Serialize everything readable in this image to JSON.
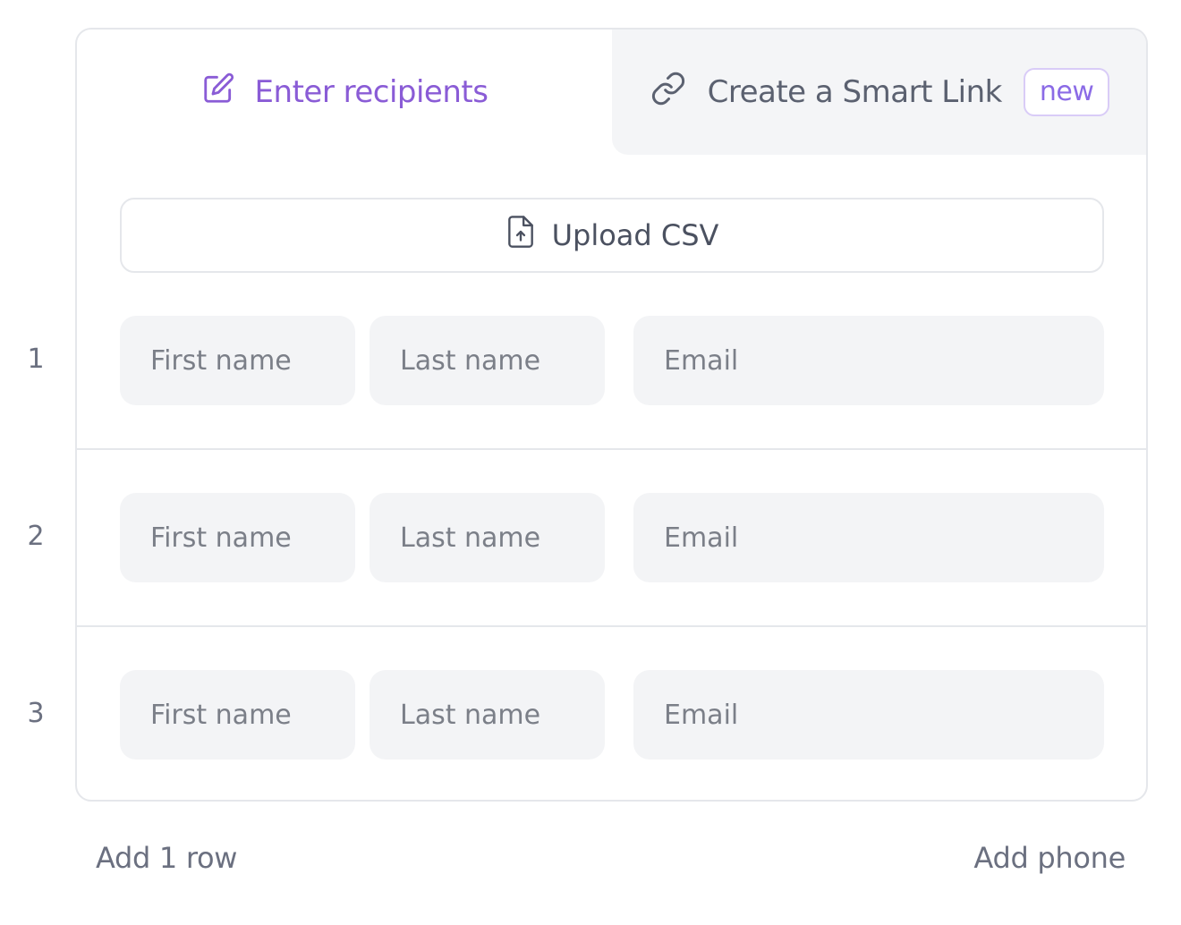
{
  "tabs": {
    "enter_label": "Enter recipients",
    "smart_label": "Create a Smart Link",
    "smart_badge": "new"
  },
  "upload": {
    "label": "Upload CSV"
  },
  "rows": [
    {
      "number": "1",
      "first_placeholder": "First name",
      "last_placeholder": "Last name",
      "email_placeholder": "Email"
    },
    {
      "number": "2",
      "first_placeholder": "First name",
      "last_placeholder": "Last name",
      "email_placeholder": "Email"
    },
    {
      "number": "3",
      "first_placeholder": "First name",
      "last_placeholder": "Last name",
      "email_placeholder": "Email"
    }
  ],
  "footer": {
    "add_row_label": "Add 1 row",
    "add_phone_label": "Add phone"
  },
  "colors": {
    "accent": "#8a5cd6",
    "field_background": "#f3f4f6",
    "border": "#e5e7eb",
    "text_muted": "#6b7080"
  },
  "icons": {
    "enter_tab": "edit-icon",
    "smart_tab": "link-icon",
    "upload": "file-upload-icon"
  }
}
